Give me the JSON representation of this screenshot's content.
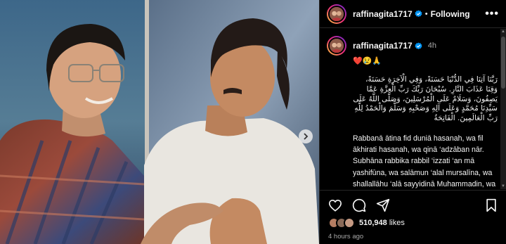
{
  "post": {
    "username": "raffinagita1717",
    "separator": "•",
    "follow_status": "Following",
    "more_label": "•••",
    "verified_icon": "verified-badge-icon",
    "accent": "#0095f6"
  },
  "caption": {
    "username": "raffinagita1717",
    "time": "4h",
    "emojis": "❤️😢🙏",
    "arabic_text": "رَبَّنَا آتِنَا فِي الدُّنْيَا حَسَنَةً، وَفِي الْآخِرَةِ حَسَنَةً، وَقِنَا عَذَابَ النَّارِ. سُبْحَانَ رَبِّكَ رَبِّ الْعِزَّةِ عَمَّا يَصِفُونَ، وَسَلَامٌ عَلَى الْمُرْسَلِينَ، وَصَلَّى اللَّهُ عَلَى سَيِّدِنَا مُحَمَّدٍ وَعَلَى آلِهِ وَصَحْبِهِ وَسَلَّمَ وَالْحَمْدُ لِلَّهِ رَبِّ الْعَالَمِينَ. الْفَاتِحَةُ",
    "latin_text": "Rabbanā ātina fid duniā hasanah, wa fil ākhirati hasanah, wa qinā ‘adzāban nār. Subhāna rabbika rabbil ‘izzati ‘an mā yashifūna, wa salāmun ‘alal mursalīna, wa shallallāhu ‘alā sayyidinā Muhammadin, wa ‘alā ālihī, wa"
  },
  "engagement": {
    "likes_count": "510,948",
    "likes_suffix": " likes",
    "posted_ago": "4 hours ago"
  },
  "icons": [
    "heart-icon",
    "comment-icon",
    "share-icon",
    "bookmark-icon",
    "chevron-right-icon"
  ]
}
